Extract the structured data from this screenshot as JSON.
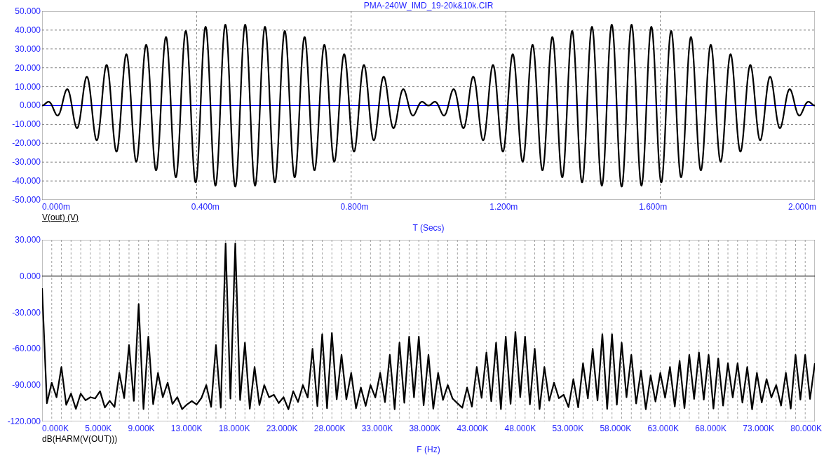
{
  "window": {
    "title": "PMA-240W_IMD_19-20k&10k.CIR"
  },
  "plots": [
    {
      "kind": "time",
      "y_ticks": [
        "50.000",
        "40.000",
        "30.000",
        "20.000",
        "10.000",
        "0.000",
        "-10.000",
        "-20.000",
        "-30.000",
        "-40.000",
        "-50.000"
      ],
      "x_ticks": [
        "0.000m",
        "0.400m",
        "0.800m",
        "1.200m",
        "1.600m",
        "2.000m"
      ],
      "trace_label": "V(out) (V)",
      "trace_underlined": true,
      "x_axis_title": "T (Secs)"
    },
    {
      "kind": "spectrum",
      "y_ticks": [
        "30.000",
        "0.000",
        "-30.000",
        "-60.000",
        "-90.000",
        "-120.000"
      ],
      "x_ticks": [
        "0.000K",
        "5.000K",
        "9.000K",
        "13.000K",
        "18.000K",
        "23.000K",
        "28.000K",
        "33.000K",
        "38.000K",
        "43.000K",
        "48.000K",
        "53.000K",
        "58.000K",
        "63.000K",
        "68.000K",
        "73.000K",
        "80.000K"
      ],
      "trace_label": "dB(HARM(V(OUT)))",
      "trace_underlined": false,
      "x_axis_title": "F (Hz)"
    }
  ]
}
